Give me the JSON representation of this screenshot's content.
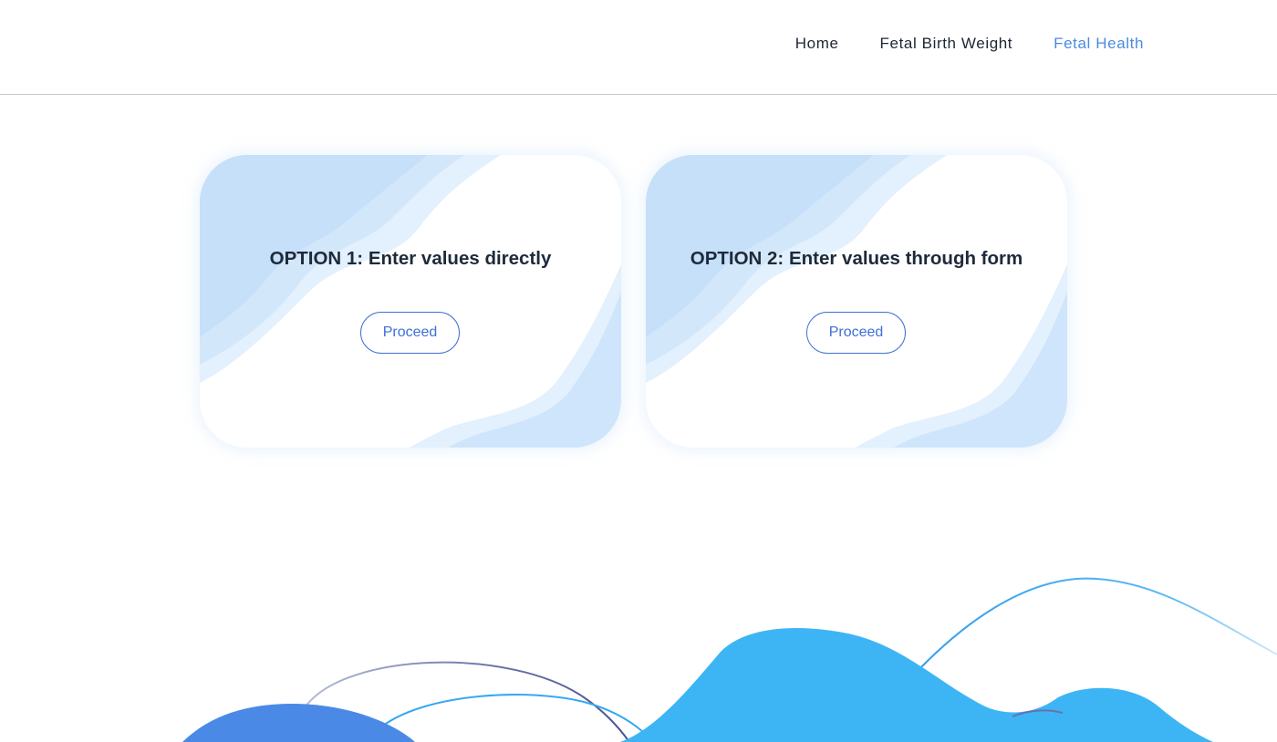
{
  "nav": {
    "items": [
      {
        "label": "Home",
        "active": false
      },
      {
        "label": "Fetal Birth Weight",
        "active": false
      },
      {
        "label": "Fetal Health",
        "active": true
      }
    ]
  },
  "cards": [
    {
      "title": "OPTION 1: Enter values directly",
      "button_label": "Proceed"
    },
    {
      "title": "OPTION 2: Enter values through form",
      "button_label": "Proceed"
    }
  ],
  "colors": {
    "accent": "#4a8be0",
    "button_border": "#3f6fd6",
    "text_dark": "#1e2a3a",
    "card_wave": "#cfe5fb",
    "wave_main": "#3db5f4",
    "wave_circle": "#4b89e6"
  }
}
